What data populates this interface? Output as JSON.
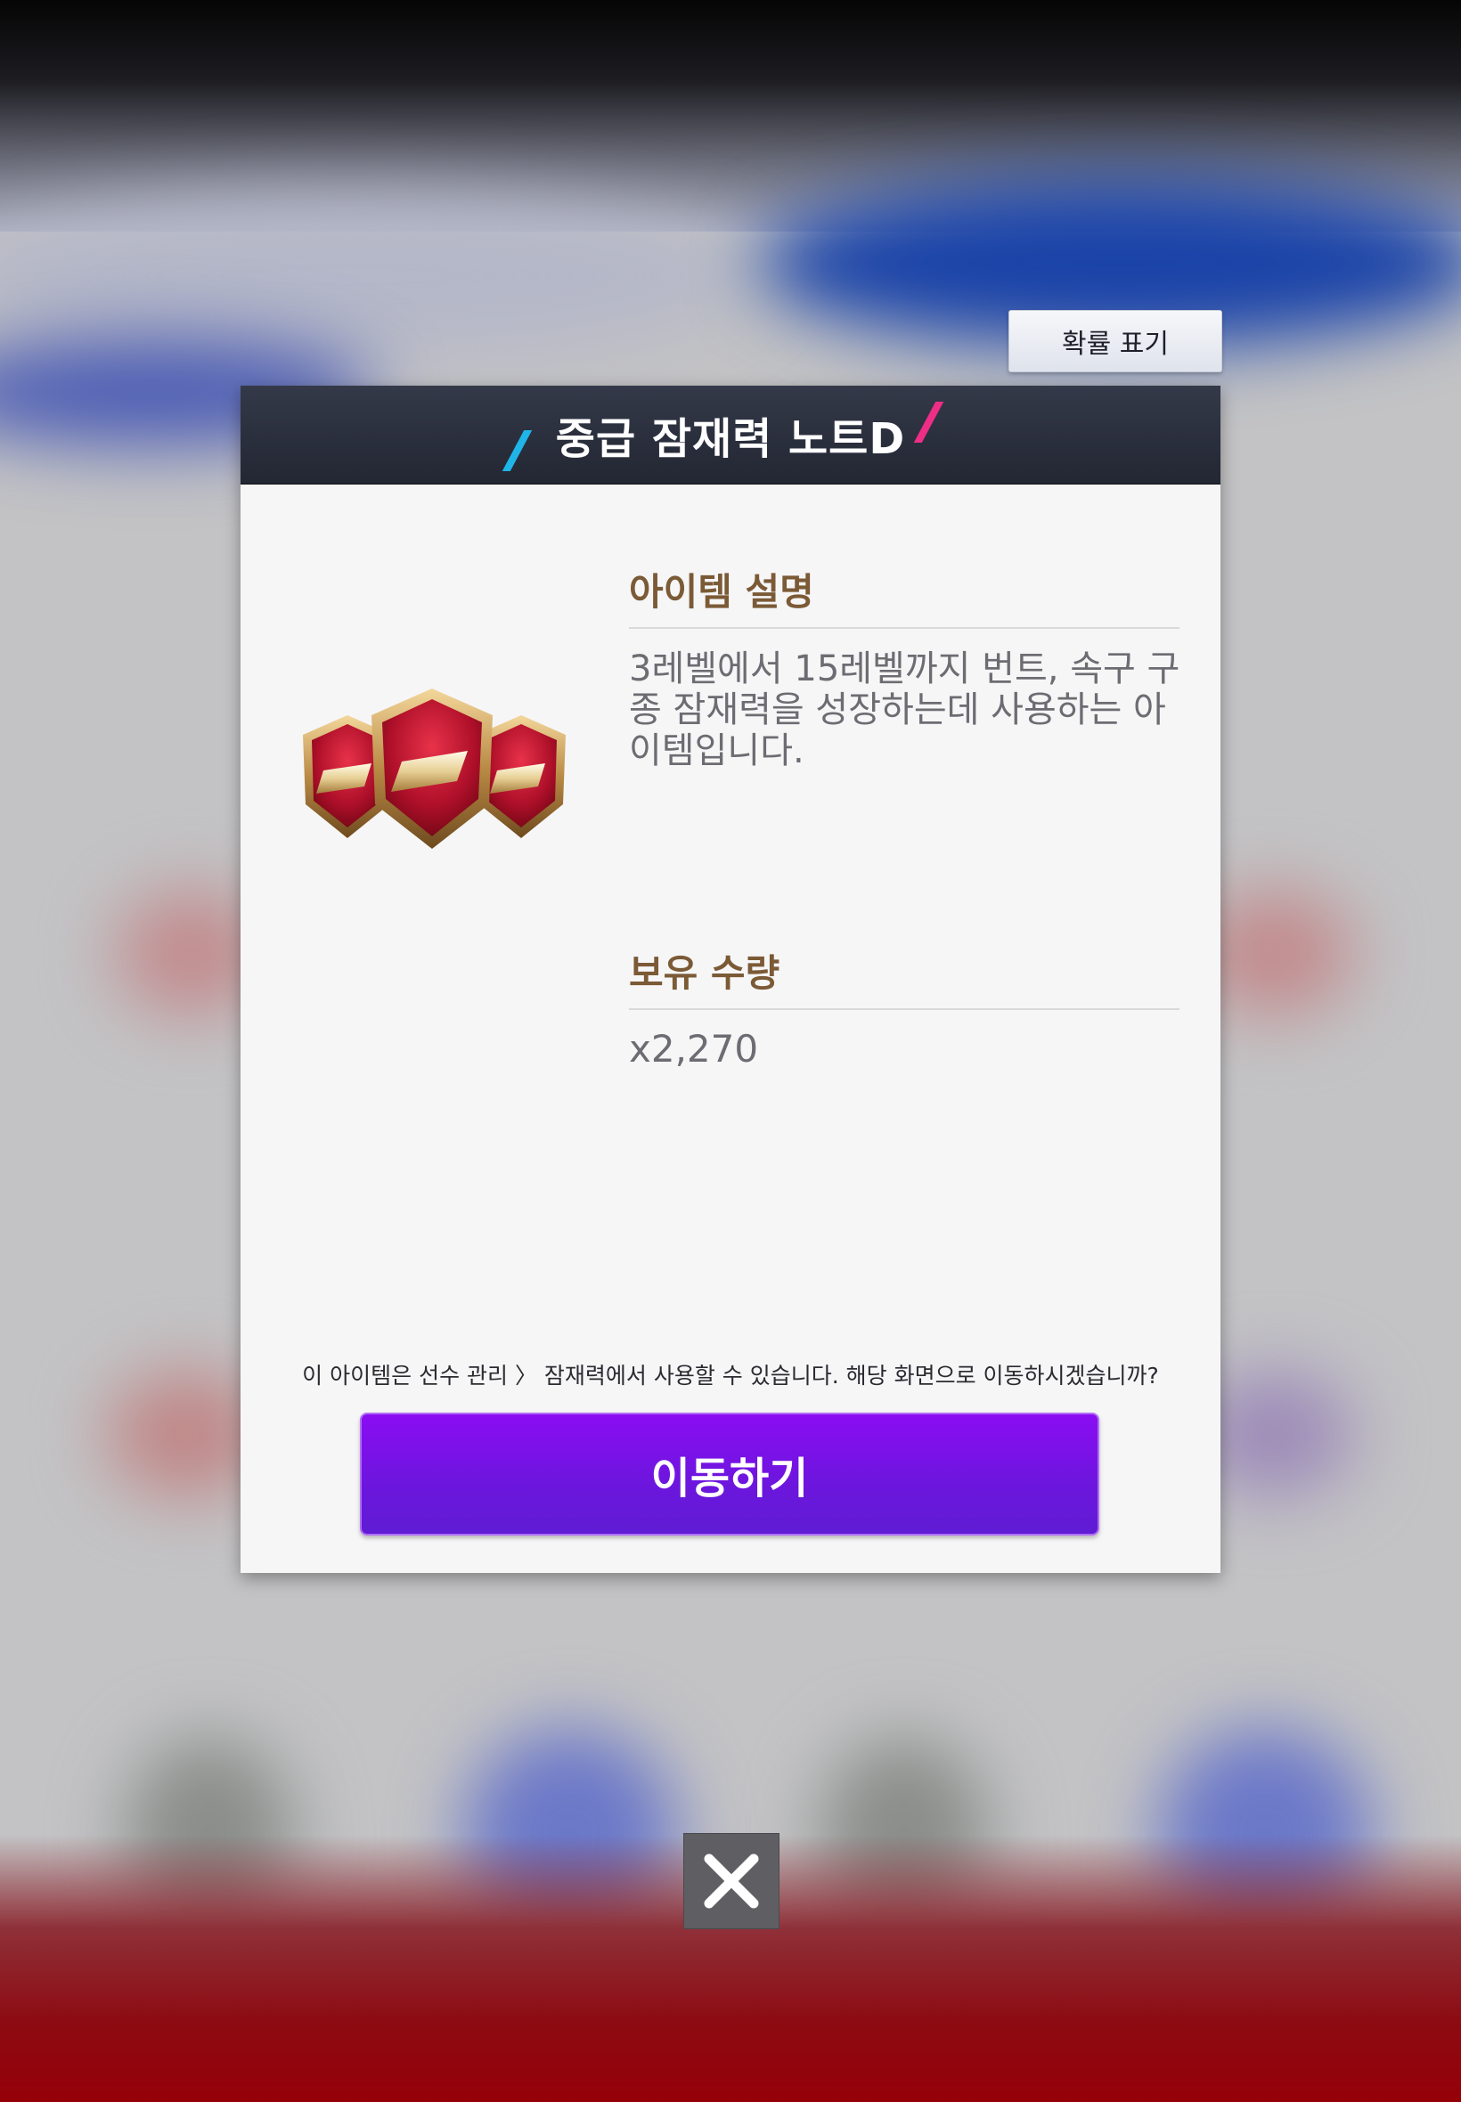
{
  "probability_button": {
    "label": "확률 표기"
  },
  "modal": {
    "title": "중급 잠재력 노트D",
    "item_icon": "red-hexagon-badge-icon",
    "description_section": {
      "title": "아이템 설명",
      "text": "3레벨에서 15레벨까지 번트, 속구 구종 잠재력을 성장하는데 사용하는 아이템입니다."
    },
    "quantity_section": {
      "title": "보유 수량",
      "value": "x2,270"
    },
    "notice": "이 아이템은 선수 관리 〉 잠재력에서 사용할 수 있습니다. 해당 화면으로 이동하시겠습니까?",
    "move_button": {
      "label": "이동하기"
    }
  },
  "close_button": {
    "icon": "close-icon"
  },
  "colors": {
    "header_bg": "#2a2e3b",
    "accent_blue": "#1fb5e8",
    "accent_pink": "#ee2e86",
    "section_title": "#7b5a36",
    "button_purple": "#7a12e8"
  }
}
